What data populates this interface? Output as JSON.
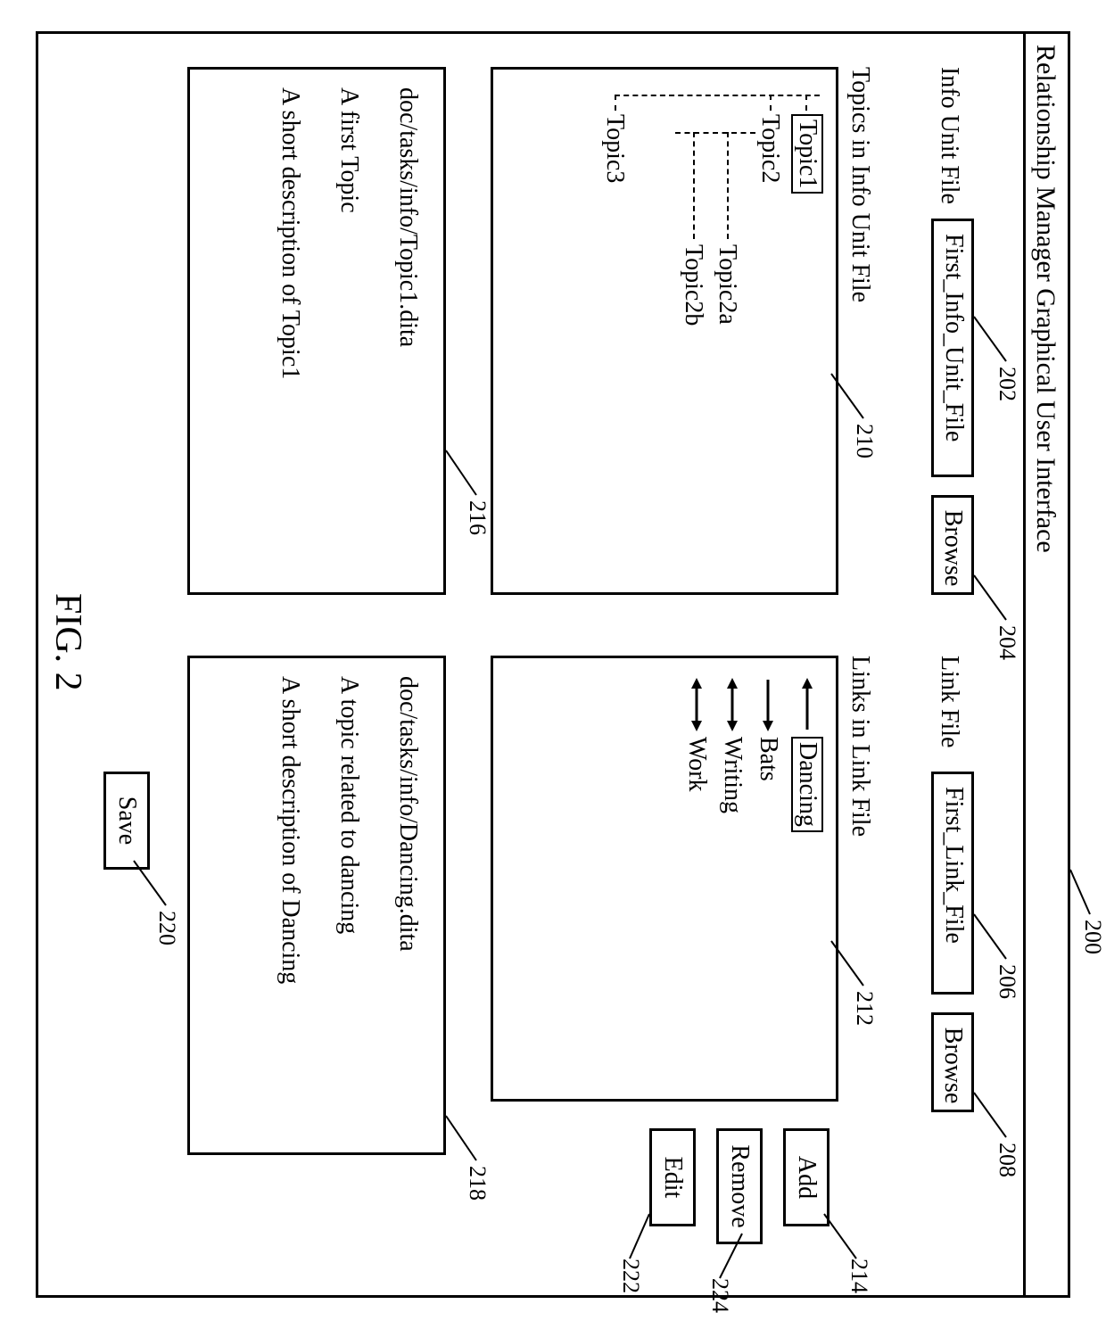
{
  "window": {
    "title": "Relationship Manager Graphical User Interface"
  },
  "info_file": {
    "label": "Info Unit File",
    "value": "First_Info_Unit_File",
    "browse": "Browse",
    "list_header": "Topics in Info Unit File"
  },
  "link_file": {
    "label": "Link File",
    "value": "First_Link_File",
    "browse": "Browse",
    "list_header": "Links in Link File"
  },
  "topics": {
    "t1": "Topic1",
    "t2": "Topic2",
    "t2a": "Topic2a",
    "t2b": "Topic2b",
    "t3": "Topic3"
  },
  "links": {
    "dancing": "Dancing",
    "bats": "Bats",
    "writing": "Writing",
    "work": "Work"
  },
  "details_left": {
    "path": "doc/tasks/info/Topic1.dita",
    "title": "A first Topic",
    "desc": "A short description of Topic1"
  },
  "details_right": {
    "path": "doc/tasks/info/Dancing.dita",
    "title": "A topic related to dancing",
    "desc": "A short description of Dancing"
  },
  "actions": {
    "add": "Add",
    "remove": "Remove",
    "edit": "Edit",
    "save": "Save"
  },
  "ref": {
    "r200": "200",
    "r202": "202",
    "r204": "204",
    "r206": "206",
    "r208": "208",
    "r210": "210",
    "r212": "212",
    "r214": "214",
    "r216": "216",
    "r218": "218",
    "r220": "220",
    "r222": "222",
    "r224": "224"
  },
  "figure": "FIG. 2"
}
